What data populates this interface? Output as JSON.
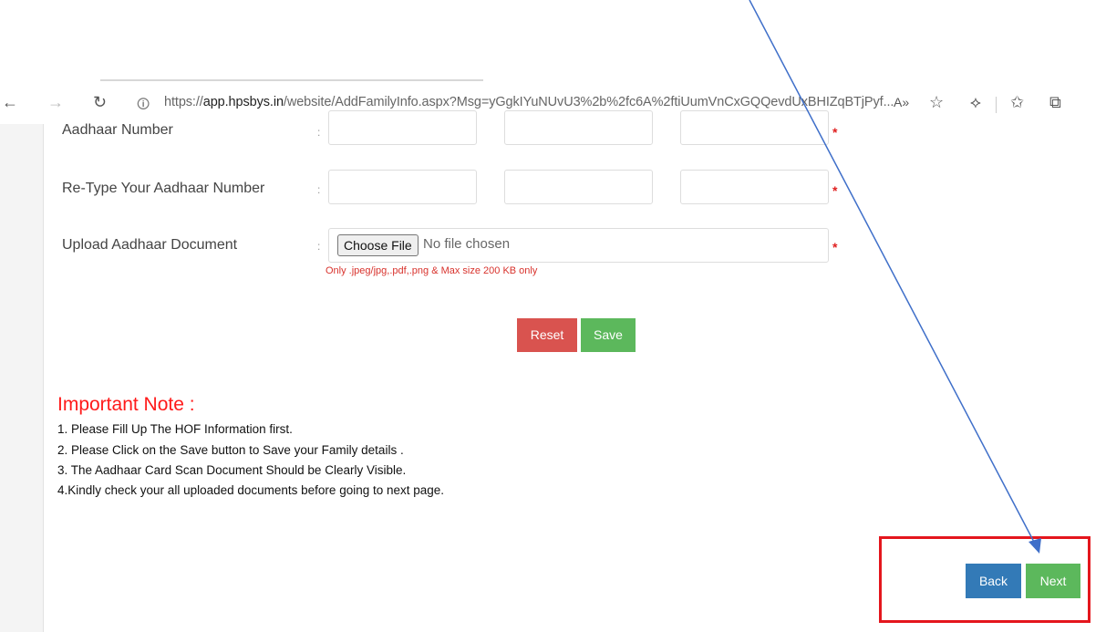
{
  "browser": {
    "url_prefix": "https://",
    "url_host": "app.hpsbys.in",
    "url_path": "/website/AddFamilyInfo.aspx?Msg=yGgkIYuNUvU3%2b%2fc6A%2ftiUumVnCxGQQevdUxBHIZqBTjPyf...",
    "icons": [
      "back-arrow-icon",
      "forward-arrow-icon",
      "refresh-icon",
      "page-info-icon",
      "read-aloud-icon",
      "favorite-add-icon",
      "extensions-icon",
      "favorites-icon",
      "collections-icon"
    ]
  },
  "form": {
    "aadhaar_label": "Aadhaar Number",
    "retype_label": "Re-Type Your Aadhaar Number",
    "upload_label": "Upload Aadhaar Document",
    "colon": ":",
    "required_mark": "*",
    "choose_file_label": "Choose File",
    "no_file_text": "No file chosen",
    "upload_hint": "Only .jpeg/jpg,.pdf,.png & Max size 200 KB only"
  },
  "actions": {
    "reset_label": "Reset",
    "save_label": "Save",
    "back_label": "Back",
    "next_label": "Next"
  },
  "note": {
    "title": "Important Note :",
    "items": [
      "1. Please Fill Up The HOF Information first.",
      "2. Please Click on the Save button to Save your Family details .",
      "3. The Aadhaar Card Scan Document Should be Clearly Visible.",
      "4.Kindly check your all uploaded documents before going to next page."
    ]
  },
  "colors": {
    "reset": "#d9534f",
    "save": "#5cb85c",
    "back": "#337ab7",
    "next": "#5cb85c",
    "required": "#e02020",
    "highlight_box": "#e4161d",
    "annotation_arrow": "#3f6fc9"
  }
}
